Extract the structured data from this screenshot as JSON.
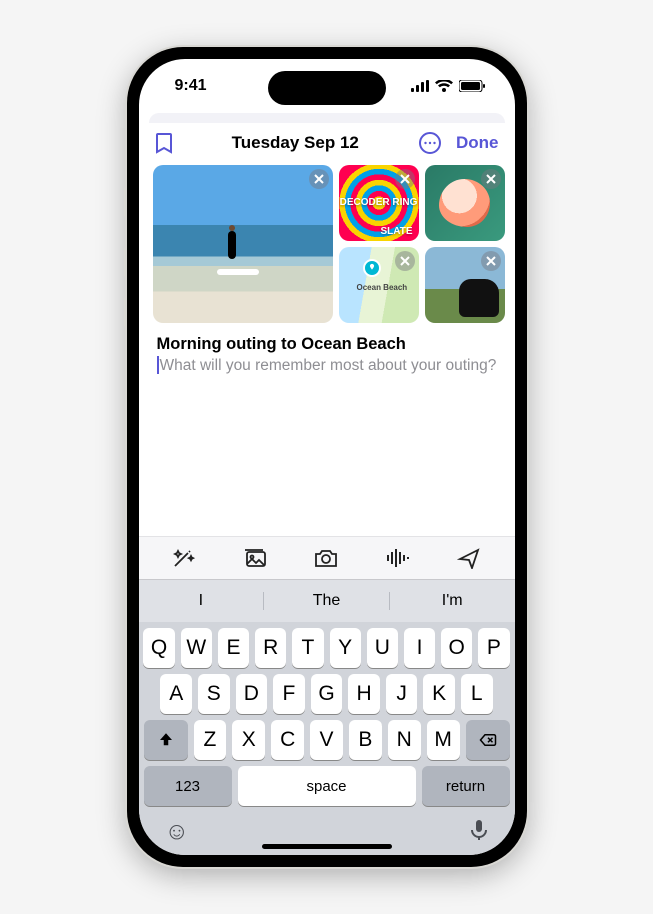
{
  "status": {
    "time": "9:41"
  },
  "nav": {
    "title": "Tuesday Sep 12",
    "done": "Done"
  },
  "attachments": {
    "decoder_text": "DECODER RING",
    "decoder_brand": "SLATE",
    "map_label": "Ocean Beach"
  },
  "entry": {
    "title": "Morning outing to Ocean Beach",
    "placeholder": "What will you remember most about your outing?"
  },
  "predictive": {
    "a": "I",
    "b": "The",
    "c": "I'm"
  },
  "keys": {
    "row1": [
      "Q",
      "W",
      "E",
      "R",
      "T",
      "Y",
      "U",
      "I",
      "O",
      "P"
    ],
    "row2": [
      "A",
      "S",
      "D",
      "F",
      "G",
      "H",
      "J",
      "K",
      "L"
    ],
    "row3": [
      "Z",
      "X",
      "C",
      "V",
      "B",
      "N",
      "M"
    ],
    "num": "123",
    "space": "space",
    "return": "return"
  }
}
